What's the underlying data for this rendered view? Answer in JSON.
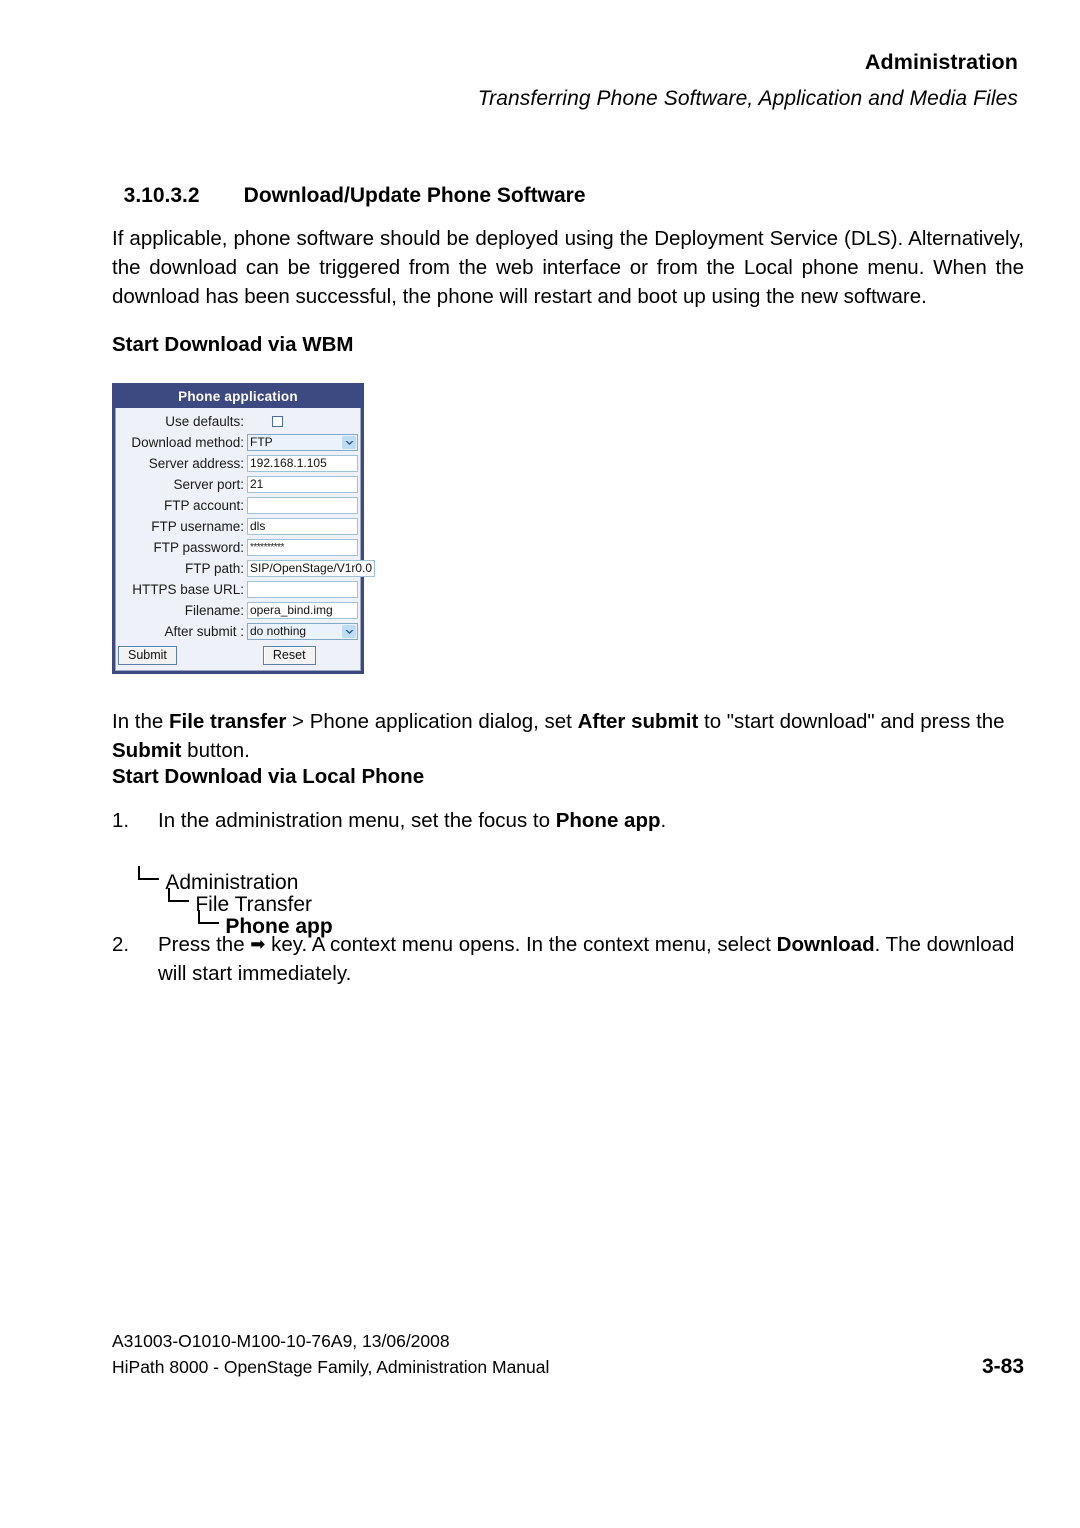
{
  "header": {
    "title": "Administration",
    "subtitle": "Transferring Phone Software, Application and Media Files"
  },
  "section": {
    "number": "3.10.3.2",
    "title": "Download/Update Phone Software"
  },
  "intro_paragraph": "If applicable, phone software should be deployed using the Deployment Service (DLS). Alternatively, the download can be triggered from the web interface or from the Local phone menu. When the download has been successful, the phone will restart and boot up using the new software.",
  "subheadings": {
    "wbm": "Start Download via WBM",
    "local_phone": "Start Download via Local Phone"
  },
  "wbm_dialog": {
    "title": "Phone application",
    "fields": [
      {
        "label": "Use defaults:",
        "type": "checkbox",
        "checked": false
      },
      {
        "label": "Download method:",
        "type": "select",
        "value": "FTP"
      },
      {
        "label": "Server address:",
        "type": "text",
        "value": "192.168.1.105"
      },
      {
        "label": "Server port:",
        "type": "text",
        "value": "21"
      },
      {
        "label": "FTP account:",
        "type": "text",
        "value": ""
      },
      {
        "label": "FTP username:",
        "type": "text",
        "value": "dls"
      },
      {
        "label": "FTP password:",
        "type": "password",
        "value": "**********"
      },
      {
        "label": "FTP path:",
        "type": "text",
        "value": "SIP/OpenStage/V1r0.0"
      },
      {
        "label": "HTTPS base URL:",
        "type": "text",
        "value": ""
      },
      {
        "label": "Filename:",
        "type": "text",
        "value": "opera_bind.img"
      },
      {
        "label": "After submit :",
        "type": "select",
        "value": "do nothing"
      }
    ],
    "submit_label": "Submit",
    "reset_label": "Reset",
    "accent_color": "#3d4a82"
  },
  "paragraph_filetransfer": {
    "part1": "In the ",
    "bold1": "File transfer",
    "part2": " > Phone application dialog, set ",
    "bold2": "After submit",
    "part3": " to \"start download\" and press the ",
    "bold3": "Submit",
    "part4": " button."
  },
  "steps": [
    {
      "number": "1.",
      "part1": "In the administration menu, set the focus to ",
      "bold1": "Phone app",
      "part2": "."
    },
    {
      "number": "2.",
      "part1": "Press the ",
      "glyph": "➡",
      "part2": " key. A context menu opens. In the context menu, select ",
      "bold1": "Download",
      "part3": ". The download will start immediately."
    }
  ],
  "menu_tree": [
    {
      "label": "Administration",
      "bold": false
    },
    {
      "label": "File Transfer",
      "bold": false
    },
    {
      "label": "Phone app",
      "bold": true
    }
  ],
  "footer": {
    "doc_id": "A31003-O1010-M100-10-76A9, 13/06/2008",
    "manual": "HiPath 8000 - OpenStage Family, Administration Manual",
    "page": "3-83"
  }
}
